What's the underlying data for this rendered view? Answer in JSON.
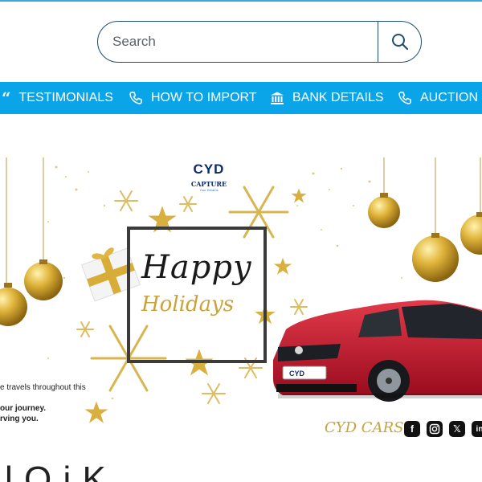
{
  "search": {
    "placeholder": "Search",
    "icon": "search-icon"
  },
  "nav": {
    "items": [
      {
        "label": "TESTIMONIALS",
        "icon": "quote-icon"
      },
      {
        "label": "HOW TO IMPORT",
        "icon": "phone-icon"
      },
      {
        "label": "BANK DETAILS",
        "icon": "bank-icon"
      },
      {
        "label": "AUCTION",
        "icon": "phone-icon"
      }
    ]
  },
  "banner": {
    "logo_main": "CYD",
    "logo_sub": "CAPTURE",
    "logo_tag": "Your Dreams",
    "greeting_line1": "Happy",
    "greeting_line2": "Holidays",
    "message_line1": "e travels throughout this",
    "message_line2": "our journey.",
    "message_line3": "rving you.",
    "plate_text": "CYD",
    "signature": "CYD CARS",
    "social": [
      "facebook-icon",
      "instagram-icon",
      "x-icon",
      "linkedin-icon"
    ]
  },
  "page": {
    "heading_partial": "l  l           O      i  K"
  },
  "colors": {
    "nav_bg": "#0aa5e8",
    "search_border": "#1f4f73",
    "gold": "#c9a33a",
    "car_red": "#c8102e",
    "logo_navy": "#0b2a6e"
  }
}
